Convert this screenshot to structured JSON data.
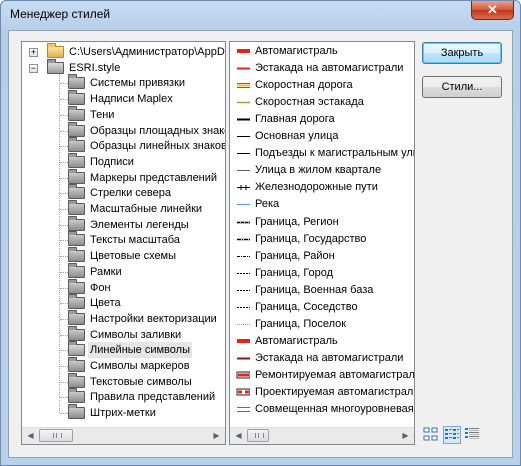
{
  "window": {
    "title": "Менеджер стилей",
    "close_glyph": "✕"
  },
  "tree": {
    "root_path": "C:\\Users\\Администратор\\AppD",
    "style_file": "ESRI.style",
    "expand_plus": "+",
    "expand_minus": "−",
    "folders": [
      {
        "label": "Системы привязки"
      },
      {
        "label": "Надписи Maplex"
      },
      {
        "label": "Тени"
      },
      {
        "label": "Образцы площадных знаков"
      },
      {
        "label": "Образцы линейных знаков"
      },
      {
        "label": "Подписи"
      },
      {
        "label": "Маркеры представлений"
      },
      {
        "label": "Стрелки севера"
      },
      {
        "label": "Масштабные линейки"
      },
      {
        "label": "Элементы легенды"
      },
      {
        "label": "Тексты масштаба"
      },
      {
        "label": "Цветовые схемы"
      },
      {
        "label": "Рамки"
      },
      {
        "label": "Фон"
      },
      {
        "label": "Цвета"
      },
      {
        "label": "Настройки векторизации"
      },
      {
        "label": "Символы заливки"
      },
      {
        "label": "Линейные символы",
        "selected": true
      },
      {
        "label": "Символы маркеров"
      },
      {
        "label": "Текстовые символы"
      },
      {
        "label": "Правила представлений"
      },
      {
        "label": "Штрих-метки"
      }
    ]
  },
  "symbols": [
    {
      "label": "Автомагистраль",
      "style": "thick-red"
    },
    {
      "label": "Эстакада на автомагистрали",
      "style": "red"
    },
    {
      "label": "Скоростная дорога",
      "style": "double-olive"
    },
    {
      "label": "Скоростная эстакада",
      "style": "olive"
    },
    {
      "label": "Главная дорога",
      "style": "black-thick"
    },
    {
      "label": "Основная улица",
      "style": "black"
    },
    {
      "label": "Подъезды к магистральным ули",
      "style": "black"
    },
    {
      "label": "Улица в жилом квартале",
      "style": "black-thin"
    },
    {
      "label": "Железнодорожные пути",
      "style": "rail"
    },
    {
      "label": "Река",
      "style": "blue"
    },
    {
      "label": "Граница, Регион",
      "style": "gray-thick"
    },
    {
      "label": "Граница, Государство",
      "style": "gray-dash"
    },
    {
      "label": "Граница, Район",
      "style": "dash-dot"
    },
    {
      "label": "Граница, Город",
      "style": "dash"
    },
    {
      "label": "Граница, Военная база",
      "style": "dash"
    },
    {
      "label": "Граница, Соседство",
      "style": "dash"
    },
    {
      "label": "Граница, Поселок",
      "style": "dot"
    },
    {
      "label": "Автомагистраль",
      "style": "thick-red"
    },
    {
      "label": "Эстакада на автомагистрали",
      "style": "darkred"
    },
    {
      "label": "Ремонтируемая автомагистраль",
      "style": "red-box"
    },
    {
      "label": "Проектируемая автомагистраль",
      "style": "red-box2"
    },
    {
      "label": "Совмещенная многоуровневая д",
      "style": "teal-double"
    }
  ],
  "buttons": {
    "close": "Закрыть",
    "styles": "Стили..."
  },
  "scrollbar": {
    "left_arrow": "◀",
    "right_arrow": "▶"
  },
  "views": [
    {
      "name": "large-icons-view",
      "selected": false
    },
    {
      "name": "list-view",
      "selected": true
    },
    {
      "name": "details-view",
      "selected": false
    }
  ]
}
